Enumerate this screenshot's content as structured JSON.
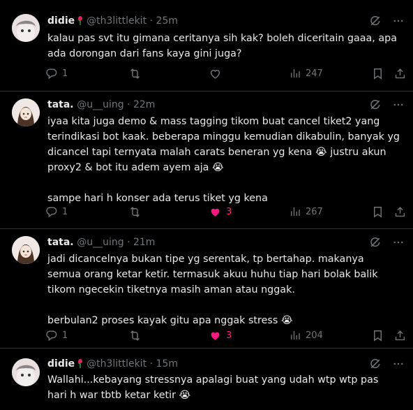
{
  "tweets": [
    {
      "name": "didie",
      "handle": "@th3littlekit",
      "time": "25m",
      "text": "kalau pas svt itu gimana ceritanya sih kak? boleh diceritain gaaa, apa ada dorongan dari fans kaya gini juga?",
      "replies": "1",
      "likes": "",
      "views": "247"
    },
    {
      "name": "tata.",
      "handle": "@u__uing",
      "time": "22m",
      "text": "iyaa kita juga demo & mass tagging tikom buat cancel tiket2 yang terindikasi bot kaak. beberapa minggu kemudian dikabulin, banyak yg dicancel tapi ternyata malah carats beneran yg kena 😭 justru akun proxy2 & bot itu adem ayem aja 😭\n\nsampe hari h konser ada terus tiket yg kena",
      "replies": "1",
      "likes": "3",
      "views": "267"
    },
    {
      "name": "tata.",
      "handle": "@u__uing",
      "time": "21m",
      "text": "jadi dicancelnya bukan tipe yg serentak, tp bertahap. makanya semua orang ketar ketir. termasuk akuu huhu tiap hari bolak balik tikom ngecekin tiketnya masih aman atau nggak.\n\nberbulan2 proses kayak gitu apa nggak stress 😭",
      "replies": "1",
      "likes": "3",
      "views": "204"
    },
    {
      "name": "didie",
      "handle": "@th3littlekit",
      "time": "15m",
      "text": "Wallahi...kebayang stressnya apalagi buat yang udah wtp wtp pas hari h war tbtb ketar ketir 😭",
      "replies": "",
      "likes": "",
      "views": ""
    }
  ],
  "colors": {
    "background": "#000000",
    "text": "#e7e9ea",
    "muted": "#71767b",
    "like": "#f91880",
    "divider": "#2f3336"
  },
  "icons": [
    "reply-icon",
    "retweet-icon",
    "heart-icon",
    "views-icon",
    "bookmark-icon",
    "share-icon",
    "grok-icon",
    "more-icon"
  ]
}
